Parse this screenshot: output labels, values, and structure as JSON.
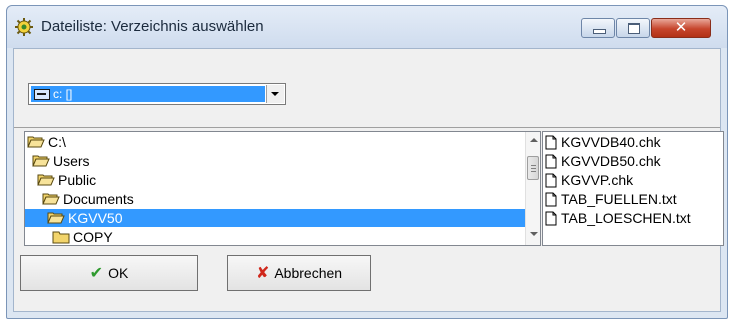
{
  "window": {
    "title": "Dateiliste: Verzeichnis auswählen",
    "icon": "yellow-gear-icon",
    "close_glyph": "✕"
  },
  "drive_select": {
    "value": "c: []",
    "icon": "drive-icon"
  },
  "directories": [
    {
      "label": "C:\\",
      "icon": "open-folder-icon",
      "selected": false
    },
    {
      "label": "Users",
      "icon": "open-folder-icon",
      "selected": false
    },
    {
      "label": "Public",
      "icon": "open-folder-icon",
      "selected": false
    },
    {
      "label": "Documents",
      "icon": "open-folder-icon",
      "selected": false
    },
    {
      "label": "KGVV50",
      "icon": "open-folder-icon",
      "selected": true
    },
    {
      "label": "COPY",
      "icon": "closed-folder-icon",
      "selected": false
    }
  ],
  "files": [
    {
      "label": "KGVVDB40.chk",
      "icon": "file-icon"
    },
    {
      "label": "KGVVDB50.chk",
      "icon": "file-icon"
    },
    {
      "label": "KGVVP.chk",
      "icon": "file-icon"
    },
    {
      "label": "TAB_FUELLEN.txt",
      "icon": "file-icon"
    },
    {
      "label": "TAB_LOESCHEN.txt",
      "icon": "file-icon"
    }
  ],
  "buttons": {
    "ok_label": "OK",
    "ok_icon": "green-check-icon",
    "cancel_label": "Abbrechen",
    "cancel_icon": "red-x-icon"
  },
  "colors": {
    "selection": "#3399ff",
    "title_bar": "#dce6f2",
    "close_button": "#c6452c",
    "folder": "#f2d46b"
  }
}
